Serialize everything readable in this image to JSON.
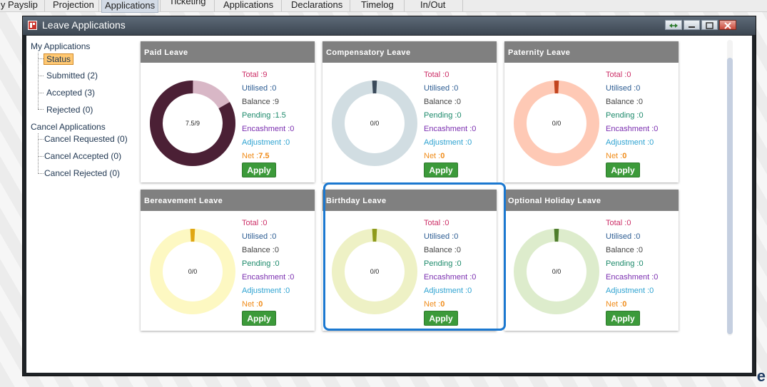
{
  "topnav": {
    "tabs": [
      "My Payslip",
      "Projection",
      "Applications",
      "Ticketing",
      "Applications",
      "Declarations",
      "Timelog",
      "In/Out"
    ],
    "active_index": 2
  },
  "dialog": {
    "title": "Leave Applications"
  },
  "tree": {
    "my_applications": {
      "label": "My Applications",
      "items": [
        "Status",
        "Submitted (2)",
        "Accepted (3)",
        "Rejected (0)"
      ],
      "selected": 0
    },
    "cancel_applications": {
      "label": "Cancel Applications",
      "items": [
        "Cancel Requested (0)",
        "Cancel Accepted (0)",
        "Cancel Rejected (0)"
      ]
    }
  },
  "labels": {
    "total": "Total :",
    "utilised": "Utilised :",
    "balance": "Balance :",
    "pending": "Pending :",
    "encashment": "Encashment :",
    "adjustment": "Adjustment :",
    "net": "Net :",
    "apply": "Apply"
  },
  "cards": [
    {
      "title": "Paid Leave",
      "ratio": "7.5/9",
      "total": "9",
      "utilised": "0",
      "balance": "9",
      "pending": "1.5",
      "encashment": "0",
      "adjustment": "0",
      "net": "7.5",
      "fraction": 0.833,
      "ring": "#4b2035",
      "track": "#d8b7c6"
    },
    {
      "title": "Compensatory Leave",
      "ratio": "0/0",
      "total": "0",
      "utilised": "0",
      "balance": "0",
      "pending": "0",
      "encashment": "0",
      "adjustment": "0",
      "net": "0",
      "fraction": 0,
      "ring": "#3a4a5a",
      "track": "#d1dde2"
    },
    {
      "title": "Paternity Leave",
      "ratio": "0/0",
      "total": "0",
      "utilised": "0",
      "balance": "0",
      "pending": "0",
      "encashment": "0",
      "adjustment": "0",
      "net": "0",
      "fraction": 0,
      "ring": "#c2451f",
      "track": "#fec9b5"
    },
    {
      "title": "Bereavement Leave",
      "ratio": "0/0",
      "total": "0",
      "utilised": "0",
      "balance": "0",
      "pending": "0",
      "encashment": "0",
      "adjustment": "0",
      "net": "0",
      "fraction": 0,
      "ring": "#e0a612",
      "track": "#fdf8c2"
    },
    {
      "title": "Birthday Leave",
      "ratio": "0/0",
      "total": "0",
      "utilised": "0",
      "balance": "0",
      "pending": "0",
      "encashment": "0",
      "adjustment": "0",
      "net": "0",
      "fraction": 0,
      "ring": "#8e9a1c",
      "track": "#eef1c5"
    },
    {
      "title": "Optional Holiday Leave",
      "ratio": "0/0",
      "total": "0",
      "utilised": "0",
      "balance": "0",
      "pending": "0",
      "encashment": "0",
      "adjustment": "0",
      "net": "0",
      "fraction": 0,
      "ring": "#4e7d2c",
      "track": "#ddeccc"
    }
  ],
  "highlighted_card": "Birthday Leave"
}
